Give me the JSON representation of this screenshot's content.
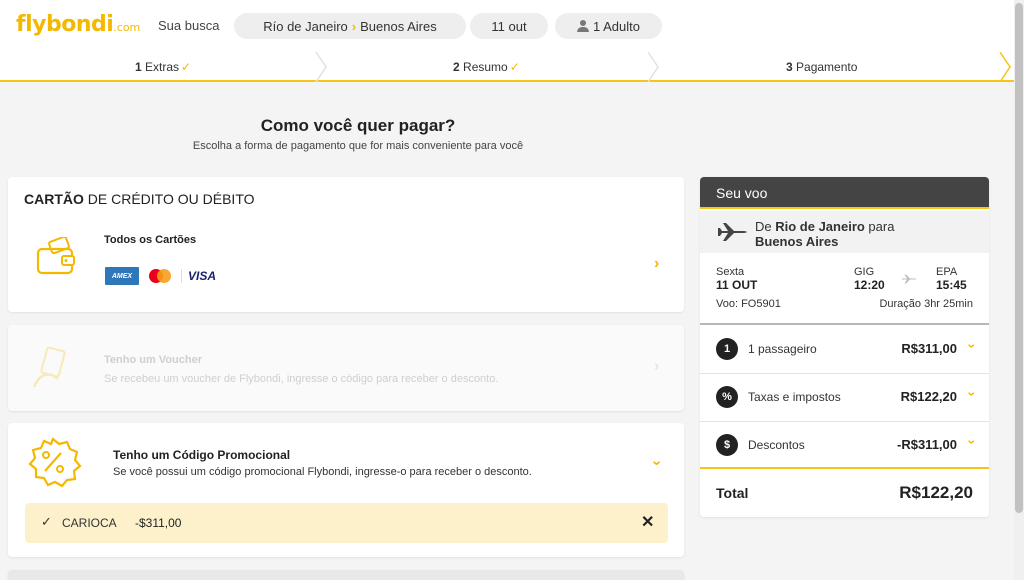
{
  "header": {
    "logo_main": "flybondi",
    "logo_suffix": ".com",
    "search_label": "Sua busca",
    "route_from": "Río de Janeiro",
    "route_to": "Buenos Aires",
    "date": "11 out",
    "passengers": "1 Adulto"
  },
  "steps": [
    {
      "number": "1",
      "label": "Extras",
      "done": "✓"
    },
    {
      "number": "2",
      "label": "Resumo",
      "done": "✓"
    },
    {
      "number": "3",
      "label": "Pagamento",
      "done": ""
    }
  ],
  "main": {
    "title": "Como você quer pagar?",
    "subtitle": "Escolha a forma de pagamento que for mais conveniente para você"
  },
  "credit_card": {
    "heading_bold": "CARTÃO",
    "heading_rest": " DE CRÉDITO OU DÉBITO",
    "option_label": "Todos os Cartões",
    "brands": [
      "AMEX",
      "VISA"
    ]
  },
  "voucher": {
    "title": "Tenho um Voucher",
    "description": "Se recebeu um voucher de Flybondi, ingresse o código para receber o desconto."
  },
  "promo": {
    "title": "Tenho um Código Promocional",
    "description": "Se você possui um código promocional Flybondi, ingresse-o para receber o desconto.",
    "applied_code": "CARIOCA",
    "applied_amount": "-$311,00"
  },
  "summary": {
    "title": "Seu voo",
    "from_prefix": "De ",
    "from_city": "Rio de Janeiro",
    "to_prefix": " para",
    "to_city": "Buenos Aires",
    "day": "Sexta",
    "date": "11 OUT",
    "origin_code": "GIG",
    "origin_time": "12:20",
    "dest_code": "EPA",
    "dest_time": "15:45",
    "flight_label": "Voo: FO5901",
    "duration_label": "Duração 3hr 25min",
    "rows": [
      {
        "icon": "1",
        "label": "1 passageiro",
        "price": "R$311,00"
      },
      {
        "icon": "%",
        "label": "Taxas e impostos",
        "price": "R$122,20"
      },
      {
        "icon": "$",
        "label": "Descontos",
        "price": "-R$311,00"
      }
    ],
    "total_label": "Total",
    "total_value": "R$122,20"
  }
}
